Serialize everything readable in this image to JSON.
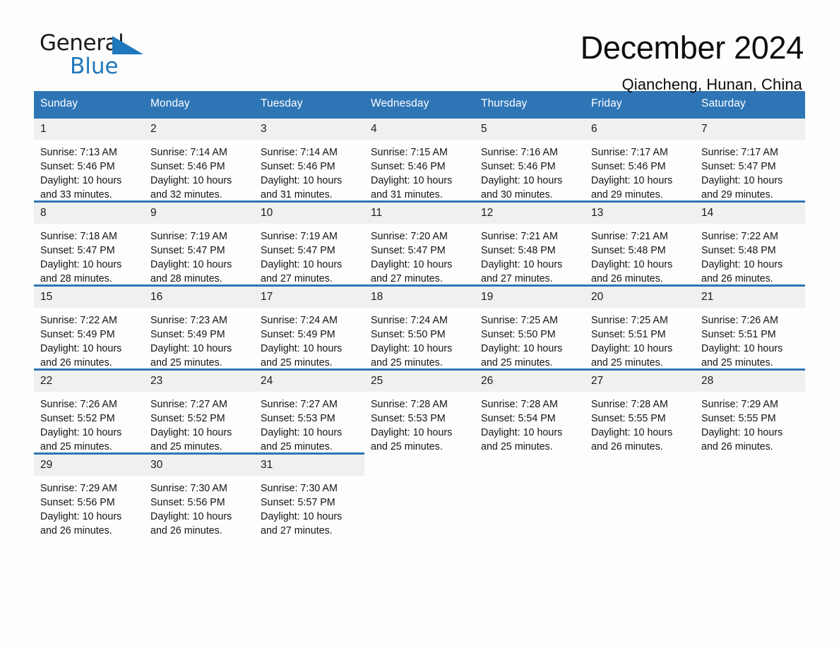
{
  "brand": {
    "name_part1": "General",
    "name_part2": "Blue",
    "logo_icon": "triangle-flag-icon",
    "accent_color": "#1f78bd"
  },
  "header": {
    "title": "December 2024",
    "location": "Qiancheng, Hunan, China"
  },
  "theme": {
    "header_blue": "#2e75b6",
    "day_band_gray": "#f0f0f0",
    "page_background": "#fdfdfd",
    "text_color": "#151515"
  },
  "calendar": {
    "weekday_headers": [
      "Sunday",
      "Monday",
      "Tuesday",
      "Wednesday",
      "Thursday",
      "Friday",
      "Saturday"
    ],
    "weeks": [
      [
        {
          "day": "1",
          "sunrise": "Sunrise: 7:13 AM",
          "sunset": "Sunset: 5:46 PM",
          "daylight": "Daylight: 10 hours and 33 minutes."
        },
        {
          "day": "2",
          "sunrise": "Sunrise: 7:14 AM",
          "sunset": "Sunset: 5:46 PM",
          "daylight": "Daylight: 10 hours and 32 minutes."
        },
        {
          "day": "3",
          "sunrise": "Sunrise: 7:14 AM",
          "sunset": "Sunset: 5:46 PM",
          "daylight": "Daylight: 10 hours and 31 minutes."
        },
        {
          "day": "4",
          "sunrise": "Sunrise: 7:15 AM",
          "sunset": "Sunset: 5:46 PM",
          "daylight": "Daylight: 10 hours and 31 minutes."
        },
        {
          "day": "5",
          "sunrise": "Sunrise: 7:16 AM",
          "sunset": "Sunset: 5:46 PM",
          "daylight": "Daylight: 10 hours and 30 minutes."
        },
        {
          "day": "6",
          "sunrise": "Sunrise: 7:17 AM",
          "sunset": "Sunset: 5:46 PM",
          "daylight": "Daylight: 10 hours and 29 minutes."
        },
        {
          "day": "7",
          "sunrise": "Sunrise: 7:17 AM",
          "sunset": "Sunset: 5:47 PM",
          "daylight": "Daylight: 10 hours and 29 minutes."
        }
      ],
      [
        {
          "day": "8",
          "sunrise": "Sunrise: 7:18 AM",
          "sunset": "Sunset: 5:47 PM",
          "daylight": "Daylight: 10 hours and 28 minutes."
        },
        {
          "day": "9",
          "sunrise": "Sunrise: 7:19 AM",
          "sunset": "Sunset: 5:47 PM",
          "daylight": "Daylight: 10 hours and 28 minutes."
        },
        {
          "day": "10",
          "sunrise": "Sunrise: 7:19 AM",
          "sunset": "Sunset: 5:47 PM",
          "daylight": "Daylight: 10 hours and 27 minutes."
        },
        {
          "day": "11",
          "sunrise": "Sunrise: 7:20 AM",
          "sunset": "Sunset: 5:47 PM",
          "daylight": "Daylight: 10 hours and 27 minutes."
        },
        {
          "day": "12",
          "sunrise": "Sunrise: 7:21 AM",
          "sunset": "Sunset: 5:48 PM",
          "daylight": "Daylight: 10 hours and 27 minutes."
        },
        {
          "day": "13",
          "sunrise": "Sunrise: 7:21 AM",
          "sunset": "Sunset: 5:48 PM",
          "daylight": "Daylight: 10 hours and 26 minutes."
        },
        {
          "day": "14",
          "sunrise": "Sunrise: 7:22 AM",
          "sunset": "Sunset: 5:48 PM",
          "daylight": "Daylight: 10 hours and 26 minutes."
        }
      ],
      [
        {
          "day": "15",
          "sunrise": "Sunrise: 7:22 AM",
          "sunset": "Sunset: 5:49 PM",
          "daylight": "Daylight: 10 hours and 26 minutes."
        },
        {
          "day": "16",
          "sunrise": "Sunrise: 7:23 AM",
          "sunset": "Sunset: 5:49 PM",
          "daylight": "Daylight: 10 hours and 25 minutes."
        },
        {
          "day": "17",
          "sunrise": "Sunrise: 7:24 AM",
          "sunset": "Sunset: 5:49 PM",
          "daylight": "Daylight: 10 hours and 25 minutes."
        },
        {
          "day": "18",
          "sunrise": "Sunrise: 7:24 AM",
          "sunset": "Sunset: 5:50 PM",
          "daylight": "Daylight: 10 hours and 25 minutes."
        },
        {
          "day": "19",
          "sunrise": "Sunrise: 7:25 AM",
          "sunset": "Sunset: 5:50 PM",
          "daylight": "Daylight: 10 hours and 25 minutes."
        },
        {
          "day": "20",
          "sunrise": "Sunrise: 7:25 AM",
          "sunset": "Sunset: 5:51 PM",
          "daylight": "Daylight: 10 hours and 25 minutes."
        },
        {
          "day": "21",
          "sunrise": "Sunrise: 7:26 AM",
          "sunset": "Sunset: 5:51 PM",
          "daylight": "Daylight: 10 hours and 25 minutes."
        }
      ],
      [
        {
          "day": "22",
          "sunrise": "Sunrise: 7:26 AM",
          "sunset": "Sunset: 5:52 PM",
          "daylight": "Daylight: 10 hours and 25 minutes."
        },
        {
          "day": "23",
          "sunrise": "Sunrise: 7:27 AM",
          "sunset": "Sunset: 5:52 PM",
          "daylight": "Daylight: 10 hours and 25 minutes."
        },
        {
          "day": "24",
          "sunrise": "Sunrise: 7:27 AM",
          "sunset": "Sunset: 5:53 PM",
          "daylight": "Daylight: 10 hours and 25 minutes."
        },
        {
          "day": "25",
          "sunrise": "Sunrise: 7:28 AM",
          "sunset": "Sunset: 5:53 PM",
          "daylight": "Daylight: 10 hours and 25 minutes."
        },
        {
          "day": "26",
          "sunrise": "Sunrise: 7:28 AM",
          "sunset": "Sunset: 5:54 PM",
          "daylight": "Daylight: 10 hours and 25 minutes."
        },
        {
          "day": "27",
          "sunrise": "Sunrise: 7:28 AM",
          "sunset": "Sunset: 5:55 PM",
          "daylight": "Daylight: 10 hours and 26 minutes."
        },
        {
          "day": "28",
          "sunrise": "Sunrise: 7:29 AM",
          "sunset": "Sunset: 5:55 PM",
          "daylight": "Daylight: 10 hours and 26 minutes."
        }
      ],
      [
        {
          "day": "29",
          "sunrise": "Sunrise: 7:29 AM",
          "sunset": "Sunset: 5:56 PM",
          "daylight": "Daylight: 10 hours and 26 minutes."
        },
        {
          "day": "30",
          "sunrise": "Sunrise: 7:30 AM",
          "sunset": "Sunset: 5:56 PM",
          "daylight": "Daylight: 10 hours and 26 minutes."
        },
        {
          "day": "31",
          "sunrise": "Sunrise: 7:30 AM",
          "sunset": "Sunset: 5:57 PM",
          "daylight": "Daylight: 10 hours and 27 minutes."
        },
        {
          "day": "",
          "sunrise": "",
          "sunset": "",
          "daylight": ""
        },
        {
          "day": "",
          "sunrise": "",
          "sunset": "",
          "daylight": ""
        },
        {
          "day": "",
          "sunrise": "",
          "sunset": "",
          "daylight": ""
        },
        {
          "day": "",
          "sunrise": "",
          "sunset": "",
          "daylight": ""
        }
      ]
    ]
  }
}
